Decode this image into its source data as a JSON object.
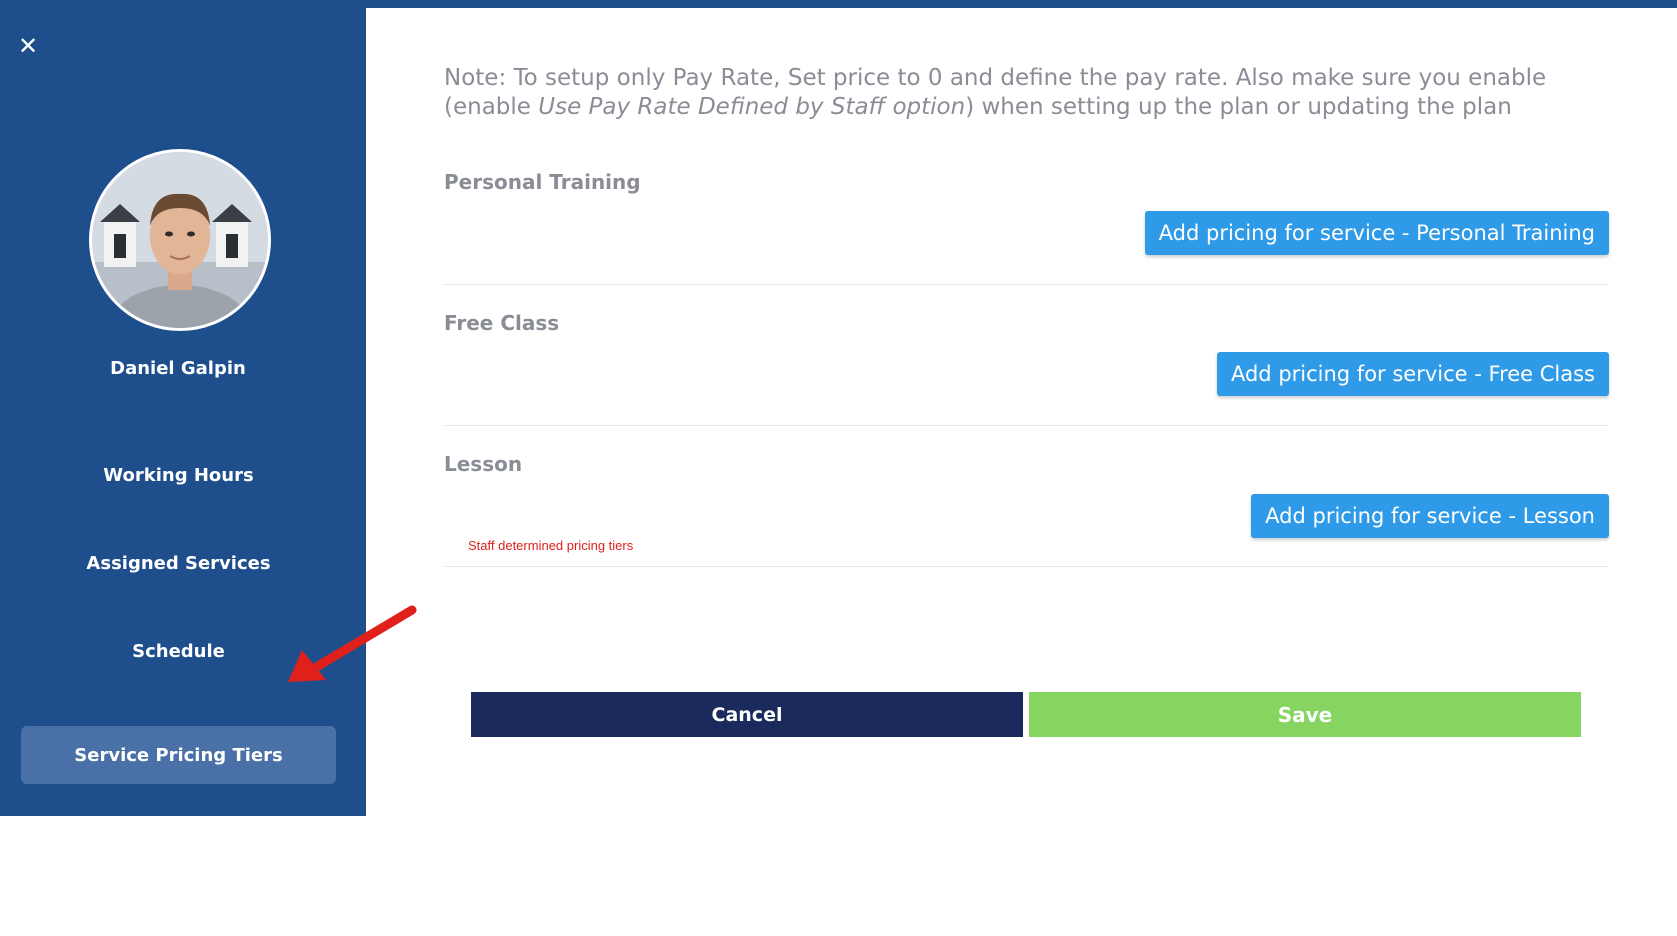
{
  "sidebar": {
    "close_icon": "close-icon",
    "close_glyph": "✕",
    "staff_name": "Daniel Galpin",
    "items": [
      {
        "label": "Working Hours",
        "active": false
      },
      {
        "label": "Assigned Services",
        "active": false
      },
      {
        "label": "Schedule",
        "active": false
      },
      {
        "label": "Service Pricing Tiers",
        "active": true
      }
    ]
  },
  "main": {
    "note_prefix": "Note: To setup only Pay Rate, Set price to 0 and define the pay rate. Also make sure you enable (enable ",
    "note_emphasis": "Use Pay Rate Defined by Staff option",
    "note_suffix": ") when setting up the plan or updating the plan",
    "services": [
      {
        "title": "Personal Training",
        "button_label": "Add pricing for service - Personal Training"
      },
      {
        "title": "Free Class",
        "button_label": "Add pricing for service - Free Class"
      },
      {
        "title": "Lesson",
        "button_label": "Add pricing for service - Lesson",
        "note": "Staff determined pricing tiers"
      }
    ]
  },
  "actions": {
    "cancel_label": "Cancel",
    "save_label": "Save"
  },
  "colors": {
    "sidebar_bg": "#1f4e8c",
    "active_item_bg": "#4a70a8",
    "add_button": "#2f9be8",
    "cancel_button": "#1a2a5c",
    "save_button": "#86d561",
    "annotation_arrow": "#e0201b",
    "tier_note": "#e0201b"
  }
}
